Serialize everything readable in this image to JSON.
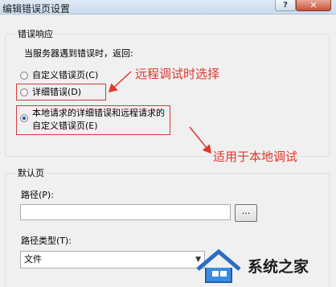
{
  "window": {
    "title": "编辑错误页设置",
    "help_glyph": "?",
    "close_glyph": "✕"
  },
  "error_response": {
    "group_title": "错误响应",
    "prompt": "当服务器遇到错误时，返回:",
    "options": [
      {
        "label": "自定义错误页(C)",
        "checked": false
      },
      {
        "label": "详细错误(D)",
        "checked": false
      },
      {
        "label_line1": "本地请求的详细错误和远程请求的",
        "label_line2": "自定义错误页(E)",
        "checked": true
      }
    ]
  },
  "annotations": {
    "remote": "远程调试时选择",
    "local": "适用于本地调试"
  },
  "default_page": {
    "group_title": "默认页",
    "path_label": "路径(P):",
    "path_value": "",
    "browse_label": "...",
    "path_type_label": "路径类型(T):",
    "path_type_value": "文件"
  },
  "watermark": {
    "text": "系统之家"
  },
  "colors": {
    "annotation": "#e0372b",
    "radio_selected": "#1c59b8"
  }
}
